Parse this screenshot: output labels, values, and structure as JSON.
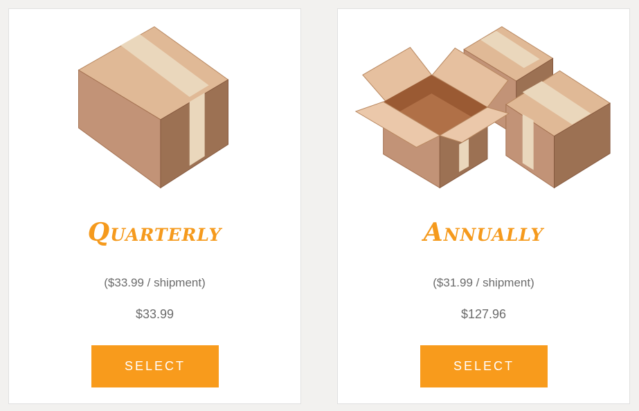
{
  "plans": [
    {
      "title": "Quarterly",
      "per_shipment": "($33.99 / shipment)",
      "price": "$33.99",
      "button_label": "SELECT",
      "image": "single-closed-box"
    },
    {
      "title": "Annually",
      "per_shipment": "($31.99 / shipment)",
      "price": "$127.96",
      "button_label": "SELECT",
      "image": "multiple-boxes-open"
    }
  ],
  "colors": {
    "accent": "#f89b1c",
    "title": "#f59a1d",
    "text": "#6b6b6b",
    "background": "#f2f1ef",
    "card": "#ffffff"
  }
}
